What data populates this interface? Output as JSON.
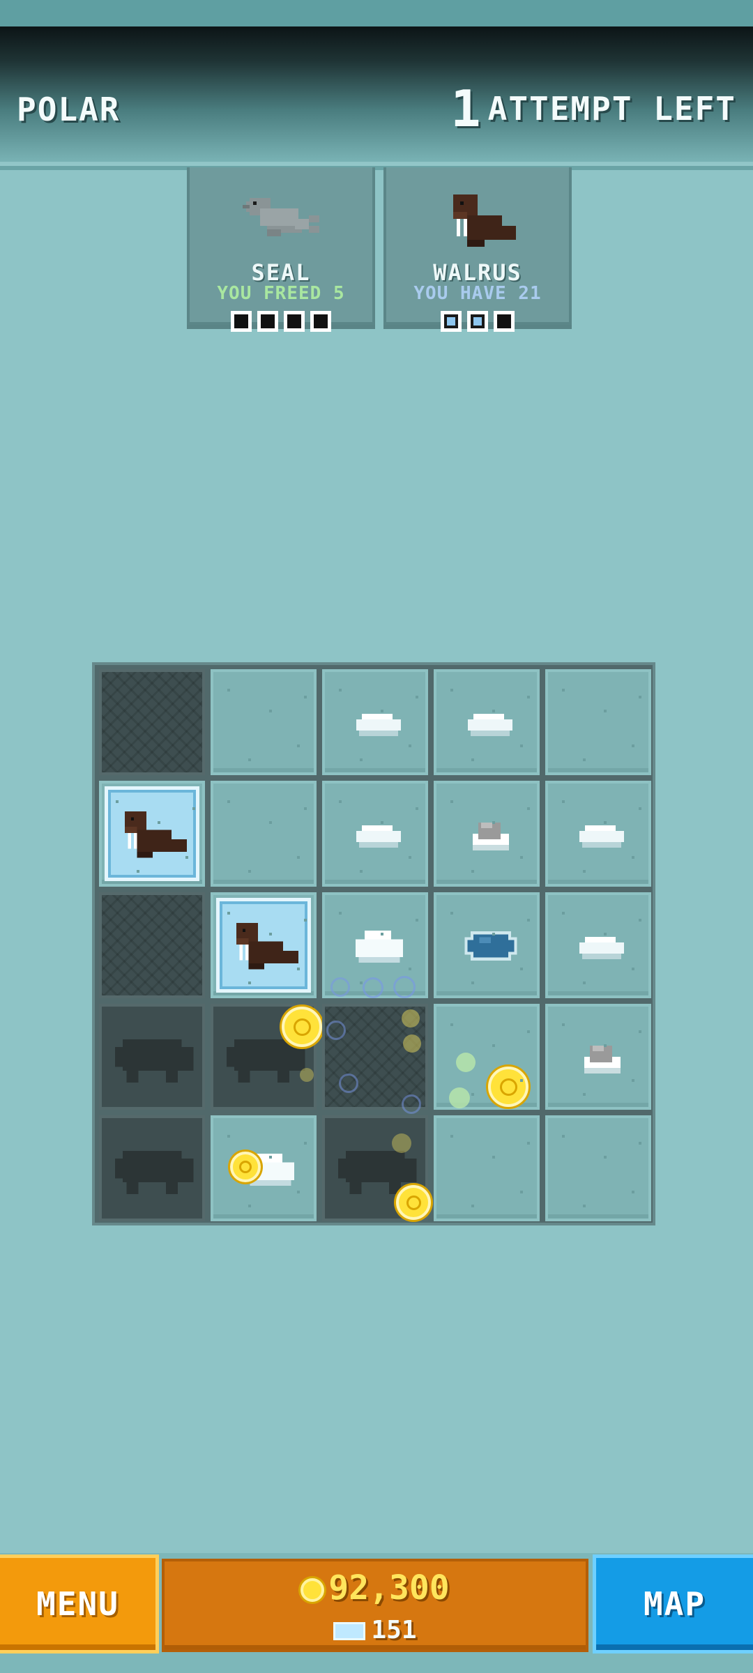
{
  "header": {
    "region_title": "POLAR",
    "attempts_count": "1",
    "attempts_label": "ATTEMPT LEFT"
  },
  "animals": [
    {
      "name": "SEAL",
      "status": "YOU FREED 5",
      "pips_total": 4,
      "pips_filled": 0,
      "icon": "seal-icon"
    },
    {
      "name": "WALRUS",
      "status": "YOU HAVE 21",
      "pips_total": 3,
      "pips_filled": 2,
      "icon": "walrus-icon"
    }
  ],
  "board": {
    "rows": 5,
    "cols": 5,
    "cells": [
      [
        "dark",
        "ice",
        "ice-floe",
        "ice-floe",
        "ice"
      ],
      [
        "walrus",
        "ice",
        "ice-floe",
        "rock",
        "ice-floe"
      ],
      [
        "dark",
        "walrus",
        "snow-chunk",
        "water-hole",
        "ice-floe"
      ],
      [
        "freed",
        "freed",
        "dark",
        "ice",
        "rock"
      ],
      [
        "freed",
        "snow-chunk",
        "freed",
        "ice",
        "ice"
      ]
    ]
  },
  "footer": {
    "menu_label": "MENU",
    "coins": "92,300",
    "gems": "151",
    "map_label": "MAP"
  },
  "colors": {
    "background": "#8ec4c6",
    "menu_orange": "#f39a0c",
    "map_blue": "#149ce6",
    "coin_yellow": "#ffe23a"
  }
}
